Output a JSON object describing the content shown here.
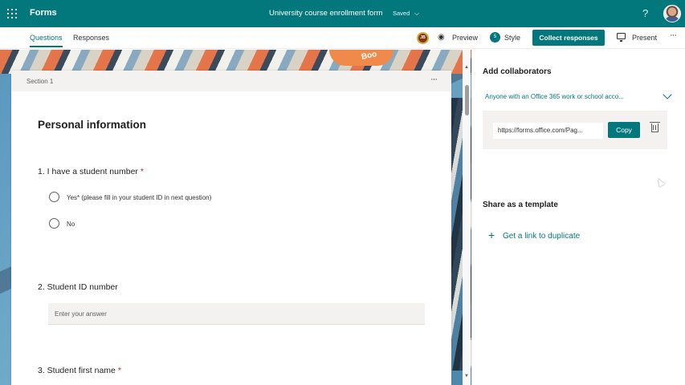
{
  "topbar": {
    "app_name": "Forms",
    "form_title": "University course enrollment form",
    "save_status": "Saved",
    "save_chevron": "⌵",
    "help": "?"
  },
  "cmdbar": {
    "tabs": [
      "Questions",
      "Responses"
    ],
    "user_initials": "JB",
    "preview_label": "Preview",
    "style_label": "Style",
    "style_badge": "5",
    "collect_label": "Collect responses",
    "present_label": "Present",
    "more": "···"
  },
  "background": {
    "book_label": "Boo"
  },
  "form": {
    "section_label": "Section 1",
    "section_more": "···",
    "section_title": "Personal information",
    "questions": [
      {
        "label": "1. I have a student number",
        "required": "*",
        "options": [
          "Yes* (please fill in your student ID in next question)",
          "No"
        ]
      },
      {
        "label": "2. Student ID number",
        "placeholder": "Enter your answer"
      },
      {
        "label": "3. Student first name",
        "required": "*"
      }
    ]
  },
  "panel": {
    "collab_title": "Add collaborators",
    "collab_option": "Anyone with an Office 365 work or school acco...",
    "link_url": "https://forms.office.com/Pag...",
    "copy_label": "Copy",
    "template_title": "Share as a template",
    "duplicate_link": "Get a link to duplicate",
    "plus": "+"
  },
  "icons": {
    "waffle": "waffle-icon",
    "eye": "eye-icon",
    "palette": "style-icon",
    "monitor": "monitor-icon",
    "trash": "trash-icon",
    "chevron": "chevron-down-icon"
  },
  "colors": {
    "accent": "#03787c",
    "required": "#a4262c"
  }
}
